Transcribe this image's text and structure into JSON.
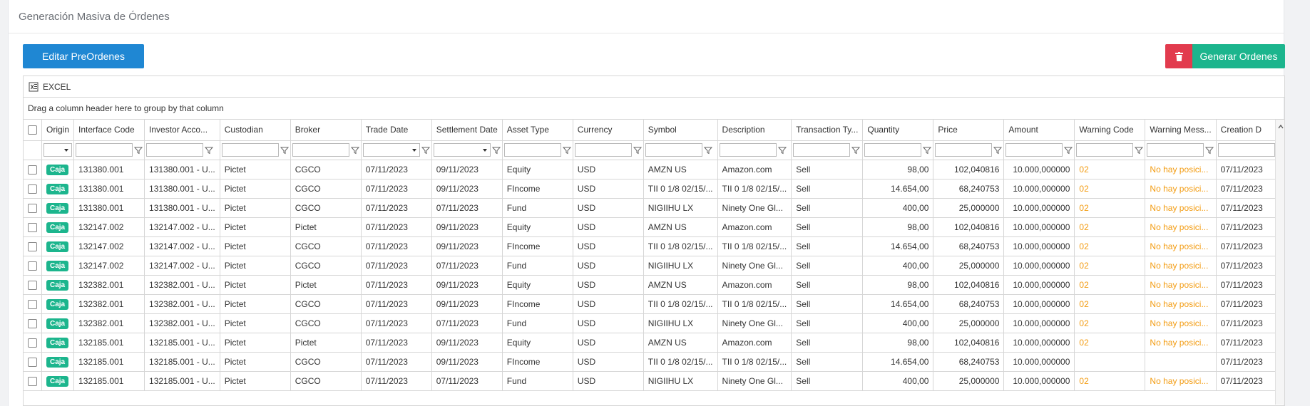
{
  "header": {
    "title": "Generación Masiva de Órdenes"
  },
  "actions": {
    "edit_label": "Editar PreOrdenes",
    "generate_label": "Generar Ordenes",
    "delete_icon": "trash-icon"
  },
  "toolbar": {
    "excel_label": "EXCEL"
  },
  "grid": {
    "group_hint": "Drag a column header here to group by that column",
    "columns": [
      "Origin",
      "Interface Code",
      "Investor Acco...",
      "Custodian",
      "Broker",
      "Trade Date",
      "Settlement Date",
      "Asset Type",
      "Currency",
      "Symbol",
      "Description",
      "Transaction Ty...",
      "Quantity",
      "Price",
      "Amount",
      "Warning Code",
      "Warning Mess...",
      "Creation D"
    ],
    "rows": [
      [
        "Caja",
        "131380.001",
        "131380.001 - U...",
        "Pictet",
        "CGCO",
        "07/11/2023",
        "09/11/2023",
        "Equity",
        "USD",
        "AMZN US",
        "Amazon.com",
        "Sell",
        "98,00",
        "102,040816",
        "10.000,000000",
        "02",
        "No hay posici...",
        "07/11/2023"
      ],
      [
        "Caja",
        "131380.001",
        "131380.001 - U...",
        "Pictet",
        "CGCO",
        "07/11/2023",
        "09/11/2023",
        "FIncome",
        "USD",
        "TII 0 1/8 02/15/...",
        "TII 0 1/8 02/15/...",
        "Sell",
        "14.654,00",
        "68,240753",
        "10.000,000000",
        "02",
        "No hay posici...",
        "07/11/2023"
      ],
      [
        "Caja",
        "131380.001",
        "131380.001 - U...",
        "Pictet",
        "CGCO",
        "07/11/2023",
        "07/11/2023",
        "Fund",
        "USD",
        "NIGIIHU LX",
        "Ninety One Gl...",
        "Sell",
        "400,00",
        "25,000000",
        "10.000,000000",
        "02",
        "No hay posici...",
        "07/11/2023"
      ],
      [
        "Caja",
        "132147.002",
        "132147.002 - U...",
        "Pictet",
        "Pictet",
        "07/11/2023",
        "09/11/2023",
        "Equity",
        "USD",
        "AMZN US",
        "Amazon.com",
        "Sell",
        "98,00",
        "102,040816",
        "10.000,000000",
        "02",
        "No hay posici...",
        "07/11/2023"
      ],
      [
        "Caja",
        "132147.002",
        "132147.002 - U...",
        "Pictet",
        "CGCO",
        "07/11/2023",
        "09/11/2023",
        "FIncome",
        "USD",
        "TII 0 1/8 02/15/...",
        "TII 0 1/8 02/15/...",
        "Sell",
        "14.654,00",
        "68,240753",
        "10.000,000000",
        "02",
        "No hay posici...",
        "07/11/2023"
      ],
      [
        "Caja",
        "132147.002",
        "132147.002 - U...",
        "Pictet",
        "CGCO",
        "07/11/2023",
        "07/11/2023",
        "Fund",
        "USD",
        "NIGIIHU LX",
        "Ninety One Gl...",
        "Sell",
        "400,00",
        "25,000000",
        "10.000,000000",
        "02",
        "No hay posici...",
        "07/11/2023"
      ],
      [
        "Caja",
        "132382.001",
        "132382.001 - U...",
        "Pictet",
        "Pictet",
        "07/11/2023",
        "09/11/2023",
        "Equity",
        "USD",
        "AMZN US",
        "Amazon.com",
        "Sell",
        "98,00",
        "102,040816",
        "10.000,000000",
        "02",
        "No hay posici...",
        "07/11/2023"
      ],
      [
        "Caja",
        "132382.001",
        "132382.001 - U...",
        "Pictet",
        "CGCO",
        "07/11/2023",
        "09/11/2023",
        "FIncome",
        "USD",
        "TII 0 1/8 02/15/...",
        "TII 0 1/8 02/15/...",
        "Sell",
        "14.654,00",
        "68,240753",
        "10.000,000000",
        "02",
        "No hay posici...",
        "07/11/2023"
      ],
      [
        "Caja",
        "132382.001",
        "132382.001 - U...",
        "Pictet",
        "CGCO",
        "07/11/2023",
        "07/11/2023",
        "Fund",
        "USD",
        "NIGIIHU LX",
        "Ninety One Gl...",
        "Sell",
        "400,00",
        "25,000000",
        "10.000,000000",
        "02",
        "No hay posici...",
        "07/11/2023"
      ],
      [
        "Caja",
        "132185.001",
        "132185.001 - U...",
        "Pictet",
        "Pictet",
        "07/11/2023",
        "09/11/2023",
        "Equity",
        "USD",
        "AMZN US",
        "Amazon.com",
        "Sell",
        "98,00",
        "102,040816",
        "10.000,000000",
        "02",
        "No hay posici...",
        "07/11/2023"
      ],
      [
        "Caja",
        "132185.001",
        "132185.001 - U...",
        "Pictet",
        "CGCO",
        "07/11/2023",
        "09/11/2023",
        "FIncome",
        "USD",
        "TII 0 1/8 02/15/...",
        "TII 0 1/8 02/15/...",
        "Sell",
        "14.654,00",
        "68,240753",
        "10.000,000000",
        "",
        "",
        "07/11/2023"
      ],
      [
        "Caja",
        "132185.001",
        "132185.001 - U...",
        "Pictet",
        "CGCO",
        "07/11/2023",
        "07/11/2023",
        "Fund",
        "USD",
        "NIGIIHU LX",
        "Ninety One Gl...",
        "Sell",
        "400,00",
        "25,000000",
        "10.000,000000",
        "02",
        "No hay posici...",
        "07/11/2023"
      ]
    ]
  },
  "colors": {
    "primary": "#1f87d3",
    "success": "#1cb58d",
    "danger": "#e23b4e",
    "warning": "#f39c12"
  }
}
